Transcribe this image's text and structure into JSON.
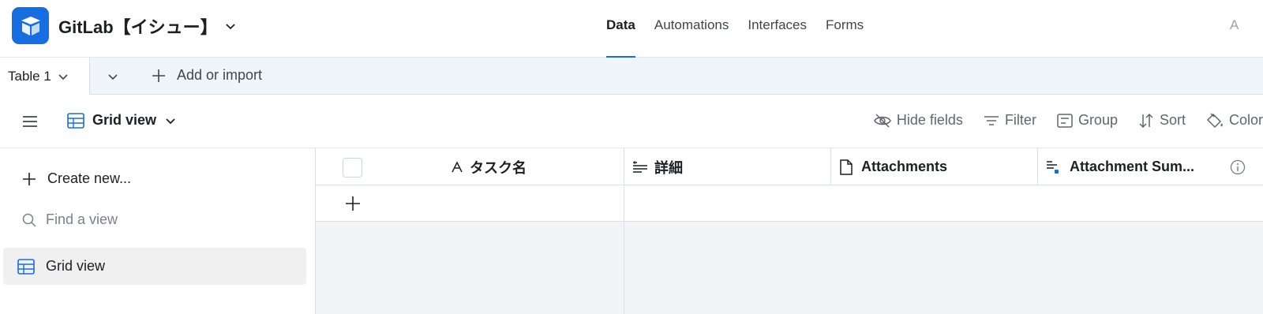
{
  "header": {
    "base_title": "GitLab【イシュー】",
    "nav": [
      {
        "label": "Data",
        "active": true
      },
      {
        "label": "Automations",
        "active": false
      },
      {
        "label": "Interfaces",
        "active": false
      },
      {
        "label": "Forms",
        "active": false
      }
    ],
    "clipped_right_text": "A"
  },
  "tabbar": {
    "table_tab_label": "Table 1",
    "add_import_label": "Add or import"
  },
  "viewbar": {
    "view_name": "Grid view",
    "tools": {
      "hide_fields": "Hide fields",
      "filter": "Filter",
      "group": "Group",
      "sort": "Sort",
      "color": "Color"
    }
  },
  "sidebar": {
    "create_new": "Create new...",
    "find_placeholder": "Find a view",
    "views": [
      {
        "label": "Grid view",
        "selected": true
      }
    ]
  },
  "grid": {
    "columns": [
      {
        "label": "タスク名",
        "icon": "text-a-icon"
      },
      {
        "label": "詳細",
        "icon": "long-text-icon"
      },
      {
        "label": "Attachments",
        "icon": "document-icon"
      },
      {
        "label": "Attachment Sum...",
        "icon": "ai-summary-icon"
      }
    ],
    "rows": []
  },
  "colors": {
    "accent": "#166ee1",
    "tabbar_bg": "#f0f4fb",
    "grid_bg": "#f3f4f6"
  }
}
